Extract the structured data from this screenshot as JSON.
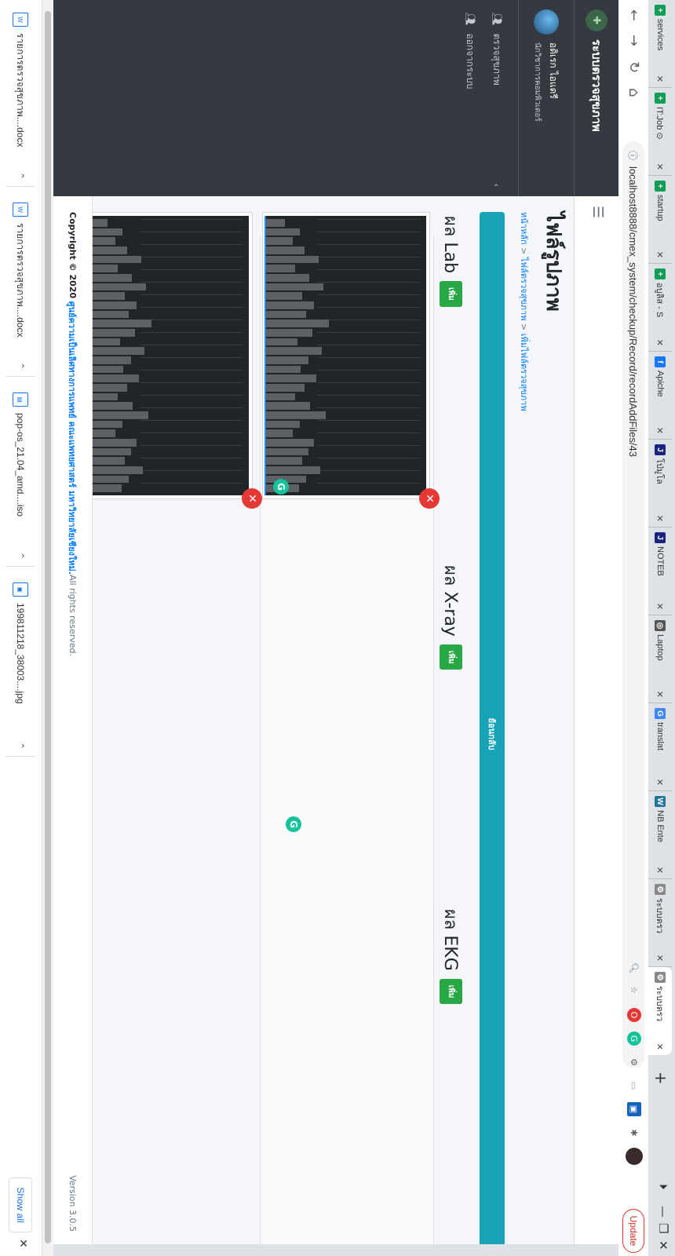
{
  "browser": {
    "tabs": [
      {
        "title": "services",
        "icon": "sheets-icon",
        "color": "#0f9d58",
        "glyph": "+"
      },
      {
        "title": "IT:Job ⊙",
        "icon": "sheets-icon",
        "color": "#0f9d58",
        "glyph": "+"
      },
      {
        "title": "startup",
        "icon": "sheets-icon",
        "color": "#0f9d58",
        "glyph": "+"
      },
      {
        "title": "อบูลิส - S",
        "icon": "sheets-icon",
        "color": "#0f9d58",
        "glyph": "+"
      },
      {
        "title": "Apiche",
        "icon": "facebook-icon",
        "color": "#1877f2",
        "glyph": "f"
      },
      {
        "title": "โป่มูโล",
        "icon": "jib-icon",
        "color": "#1a237e",
        "glyph": "J"
      },
      {
        "title": "NOTEB",
        "icon": "jib-icon",
        "color": "#1a237e",
        "glyph": "J"
      },
      {
        "title": "Laptop",
        "icon": "globe-icon",
        "color": "#555555",
        "glyph": "◎"
      },
      {
        "title": "translat",
        "icon": "google-icon",
        "color": "#4285f4",
        "glyph": "G"
      },
      {
        "title": "NB Ente",
        "icon": "wordpress-icon",
        "color": "#21759b",
        "glyph": "W"
      },
      {
        "title": "ระบบตรว",
        "icon": "page-icon",
        "color": "#888888",
        "glyph": "⚙"
      },
      {
        "title": "ระบบตรว",
        "icon": "page-icon",
        "color": "#888888",
        "glyph": "⚙",
        "active": true
      }
    ],
    "new_tab": "+",
    "url": "localhost8888/cmex_system/checkup/Record/recordAddFiles/43",
    "update_label": "Update"
  },
  "sidebar": {
    "brand": "ระบบตรวจสุขภาพ",
    "user_name": "อดิเรก ไอแดรี",
    "user_role": "นักวิชาการคอมพิวเตอร์",
    "items": [
      {
        "label": "ตรวจสุขภาพ",
        "icon": "users-icon"
      },
      {
        "label": "ออกจากระบบ",
        "icon": "users-icon"
      }
    ]
  },
  "main": {
    "title": "ไฟล์รูปภาพ",
    "breadcrumb": {
      "home": "หน้าหลัก",
      "sep": " > ",
      "mid": "ไฟล์ตรวจสุขภาพ",
      "current": "เพิ่มไฟล์ตรวจสุขภาพ"
    },
    "back_label": "ย้อนกลับ",
    "sections": [
      {
        "title": "ผล Lab",
        "add_label": "เพิ่ม"
      },
      {
        "title": "ผล X-ray",
        "add_label": "เพิ่ม"
      },
      {
        "title": "ผล EKG",
        "add_label": "เพิ่ม"
      }
    ]
  },
  "footer": {
    "copyright": "Copyright © 2020",
    "org": "ศูนย์ความเป็นเลิศทางการแพทย์ คณะแพทยศาสตร์ มหาวิทยาลัยเชียงใหม่.",
    "rights": " All rights reserved.",
    "version": "Version 3.0.5"
  },
  "downloads": {
    "items": [
      {
        "name": "รายการตรวจสุขภาพ....docx"
      },
      {
        "name": "รายการตรวจสุขภาพ....docx"
      },
      {
        "name": "pop-os_21.04_amd....iso"
      },
      {
        "name": "199811218_38003....jpg"
      }
    ],
    "show_all": "Show all"
  },
  "colors": {
    "accent": "#17a2b8",
    "add_button": "#28a745",
    "delete": "#e53935",
    "sidebar": "#343a40"
  }
}
